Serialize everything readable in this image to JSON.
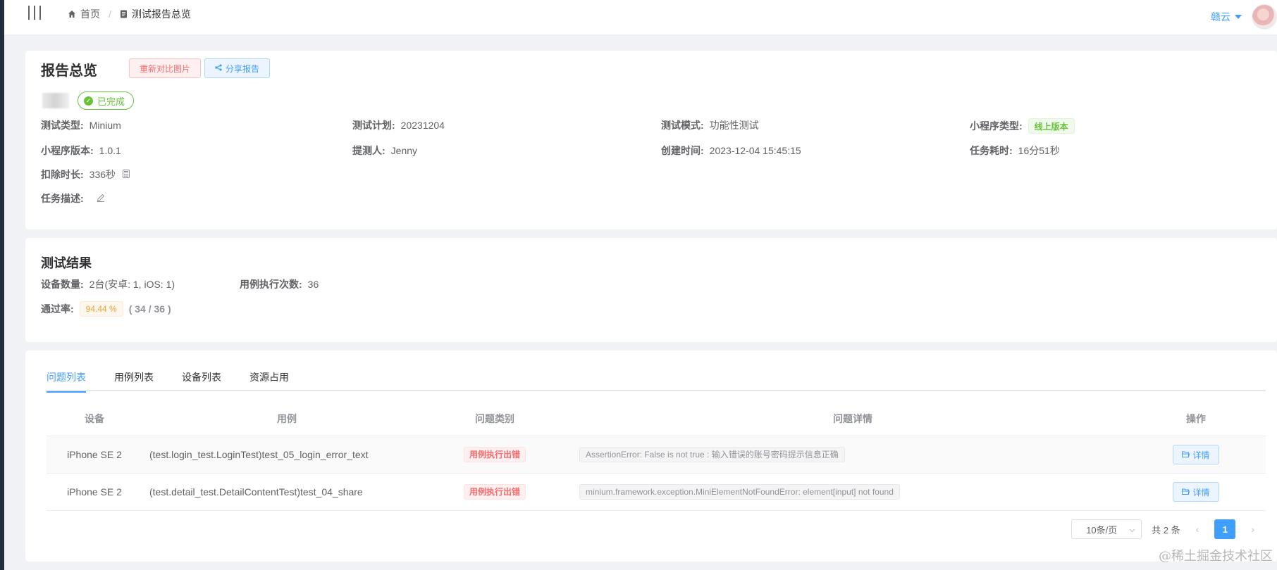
{
  "header": {
    "breadcrumbs": [
      "首页",
      "测试报告总览"
    ],
    "breadcrumb_sep": "/",
    "user_name": "赣云"
  },
  "overview": {
    "title": "报告总览",
    "rediff_button": "重新对比图片",
    "share_button": "分享报告",
    "status": "已完成",
    "fields": {
      "test_type_label": "测试类型:",
      "test_type": "Minium",
      "plan_label": "测试计划:",
      "plan": "20231204",
      "mode_label": "测试模式:",
      "mode": "功能性测试",
      "app_type_label": "小程序类型:",
      "app_type": "线上版本",
      "version_label": "小程序版本:",
      "version": "1.0.1",
      "submitter_label": "提测人:",
      "submitter": "Jenny",
      "created_label": "创建时间:",
      "created": "2023-12-04 15:45:15",
      "duration_label": "任务耗时:",
      "duration": "16分51秒",
      "deduct_label": "扣除时长:",
      "deduct": "336秒",
      "desc_label": "任务描述:"
    }
  },
  "results": {
    "title": "测试结果",
    "devices_label": "设备数量:",
    "devices": "2台(安卓: 1, iOS: 1)",
    "runs_label": "用例执行次数:",
    "runs": "36",
    "pass_label": "通过率:",
    "pass_rate": "94.44 %",
    "pass_count": "( 34 / 36 )"
  },
  "tabs": [
    "问题列表",
    "用例列表",
    "设备列表",
    "资源占用"
  ],
  "table": {
    "headers": [
      "设备",
      "用例",
      "问题类别",
      "问题详情",
      "操作"
    ],
    "rows": [
      {
        "device": "iPhone SE 2",
        "case": "(test.login_test.LoginTest)test_05_login_error_text",
        "category": "用例执行出错",
        "detail": "AssertionError: False is not true : 输入错误的账号密码提示信息正确",
        "action": "详情"
      },
      {
        "device": "iPhone SE 2",
        "case": "(test.detail_test.DetailContentTest)test_04_share",
        "category": "用例执行出错",
        "detail": "minium.framework.exception.MiniElementNotFoundError: element[input] not found",
        "action": "详情"
      }
    ]
  },
  "pagination": {
    "page_size": "10条/页",
    "total": "共 2 条",
    "current_page": "1"
  },
  "watermark": "@稀土掘金技术社区",
  "colors": {
    "primary": "#409eff",
    "success": "#67c23a",
    "danger": "#f56c6c",
    "warning": "#e6a23c"
  }
}
